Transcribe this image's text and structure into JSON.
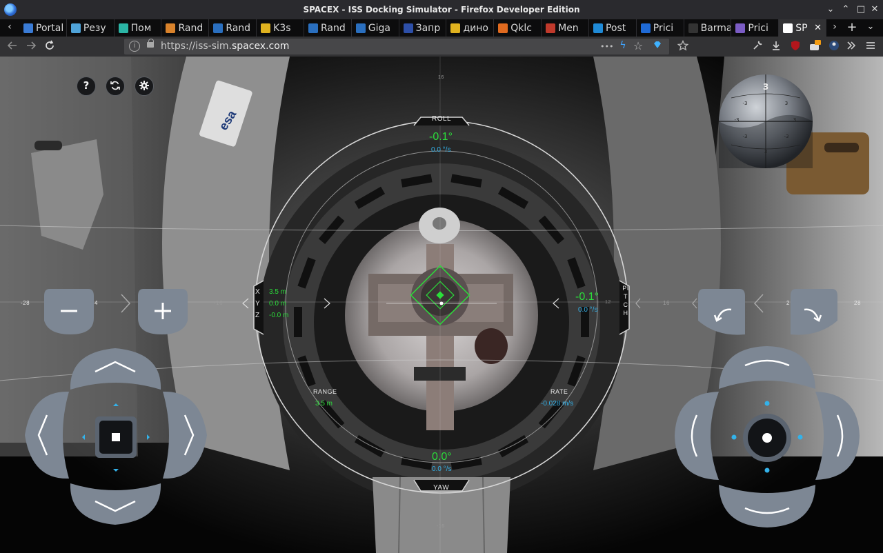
{
  "window": {
    "title": "SPACEX - ISS Docking Simulator - Firefox Developer Edition",
    "minimize": "⌄",
    "maximize": "⌃",
    "restore": "□",
    "close": "✕"
  },
  "tabs": [
    {
      "label": "Portal",
      "color": "#3a7bd5"
    },
    {
      "label": "Резу",
      "color": "#4fa3d8"
    },
    {
      "label": "Пом",
      "color": "#2bb5a5"
    },
    {
      "label": "Rand",
      "color": "#d9822b"
    },
    {
      "label": "Rand",
      "color": "#2a6fbf"
    },
    {
      "label": "K3s",
      "color": "#e0b21f"
    },
    {
      "label": "Rand",
      "color": "#2a6fbf"
    },
    {
      "label": "Giga",
      "color": "#2a6fbf"
    },
    {
      "label": "Запр",
      "color": "#2d4fa8"
    },
    {
      "label": "дино",
      "color": "#e0b21f"
    },
    {
      "label": "Qklc",
      "color": "#e06a1f"
    },
    {
      "label": "Men",
      "color": "#c0392b"
    },
    {
      "label": "Post",
      "color": "#1f8ad6"
    },
    {
      "label": "Prici",
      "color": "#1f6ad6"
    },
    {
      "label": "Barman",
      "color": "#333333"
    },
    {
      "label": "Prici",
      "color": "#7b5cc4"
    },
    {
      "label": "SP",
      "color": "#ffffff",
      "active": true,
      "close": "✕"
    }
  ],
  "tabbar": {
    "scroll_left": "‹",
    "scroll_right": "›",
    "new_tab": "+",
    "all_tabs": "⌄"
  },
  "url": {
    "prefix": "https://iss-sim.",
    "host": "spacex.com"
  },
  "urlbar_icons": {
    "more": "•••",
    "bolt": "ϟ",
    "star": "☆"
  },
  "hud": {
    "roll": {
      "label": "ROLL",
      "angle": "-0.1°",
      "rate": "0.0 °/s"
    },
    "pitch": {
      "label": "PITCH",
      "angle": "-0.1°",
      "rate": "0.0 °/s"
    },
    "yaw": {
      "label": "YAW",
      "angle": "0.0°",
      "rate": "0.0 °/s"
    },
    "xyz": {
      "x_label": "X",
      "y_label": "Y",
      "z_label": "Z",
      "x_value": "3.5 m",
      "y_value": "0.0 m",
      "z_value": "-0.0 m"
    },
    "range": {
      "label": "RANGE",
      "value": "3.5 m"
    },
    "rate": {
      "label": "RATE",
      "value": "-0.028 m/s"
    }
  },
  "scales": {
    "left": [
      "-28",
      "4",
      "-16"
    ],
    "right": [
      "16",
      "2",
      "28"
    ],
    "top_tick": "16",
    "bottom_tick": "-16",
    "pitch_mid": "12"
  },
  "globe_marks": [
    "3",
    "-3",
    "3",
    "-3",
    "-3",
    "3",
    "-3",
    "3"
  ],
  "esa_label": "esa",
  "help_button": "?",
  "colors": {
    "green": "#2bde3a",
    "blue": "#33b2ea",
    "ring": "#d6d6d6"
  }
}
